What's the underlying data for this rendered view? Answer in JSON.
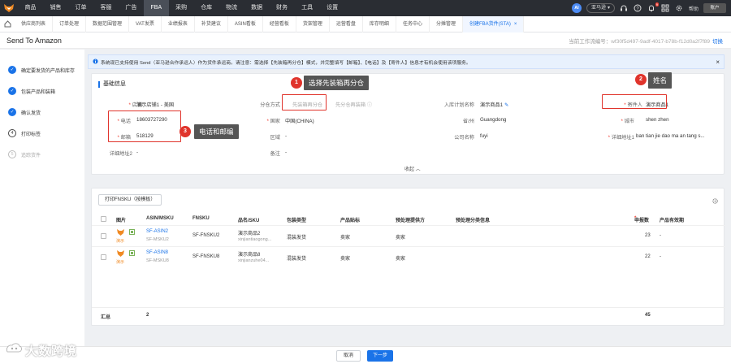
{
  "nav": {
    "items": [
      "商品",
      "销售",
      "订单",
      "客服",
      "广告",
      "FBA",
      "采购",
      "仓库",
      "物流",
      "数据",
      "财务",
      "工具",
      "设置"
    ],
    "active": "FBA",
    "ai_label": "AI",
    "user_label": "亚马逊",
    "notification_count": "9",
    "help_label": "帮助",
    "account_label": "账户"
  },
  "tabs": {
    "items": [
      "供应商列表",
      "订单处理",
      "数据范围管理",
      "VAT发票",
      "业绩报表",
      "补货建议",
      "ASIN看板",
      "经营看板",
      "货架管理",
      "运营看盘",
      "库存明细",
      "任务中心",
      "分摊管理"
    ],
    "active_label": "创建FBA货件(STA)",
    "close_glyph": "×"
  },
  "page": {
    "title": "Send To Amazon",
    "flow_label": "当前工作流编号：",
    "flow_id": "wf30f5d497-9adf-4017-b78b-f12d0a2f7f89",
    "switch_label": "切换"
  },
  "steps": [
    {
      "label": "确定要发货的产品和库存",
      "state": "done",
      "glyph": "✓"
    },
    {
      "label": "包装产品和装箱",
      "state": "done",
      "glyph": "✓"
    },
    {
      "label": "确认发货",
      "state": "done",
      "glyph": "✓"
    },
    {
      "label": "打印标签",
      "state": "current",
      "glyph": "4"
    },
    {
      "label": "追踪货件",
      "state": "todo",
      "glyph": "5"
    }
  ],
  "notice": {
    "text": "系统现已支持使用 Send（亚马逊合作承运人）作为货件承运商。请注意：需选择【先装箱再分仓】模式，并完整填写【邮箱】、【电话】及【寄件人】信息才有机会使用该项服务。",
    "close_glyph": "×"
  },
  "basic": {
    "title": "基础信息",
    "store_label": "店铺",
    "store_value": "演示店铺1 - 美国",
    "mode_label": "分仓方式",
    "mode_option1": "先装箱再分仓",
    "mode_option2": "先分仓再装箱",
    "plan_label": "入库计划名称",
    "plan_value": "演示商品1",
    "sender_label": "寄件人",
    "sender_value": "演示商品1",
    "phone_label": "电话",
    "phone_value": "18603727290",
    "country_label": "国家",
    "country_value": "中国(CHINA)",
    "province_label": "省/州",
    "province_value": "Guangdong",
    "city_label": "城市",
    "city_value": "shen zhen",
    "email_label": "邮箱",
    "email_value": "518129",
    "district_label": "区域",
    "district_value": "-",
    "company_label": "公司名称",
    "company_value": "fuyi",
    "address1_label": "详细地址1",
    "address1_value": "ban tian jie dao ma an tang s...",
    "address2_label": "详细地址2",
    "address2_value": "-",
    "remark_label": "备注",
    "remark_value": "-",
    "collapse_label": "收起 ︿"
  },
  "annotations": {
    "callout1_num": "1",
    "callout1_text": "选择先装箱再分仓",
    "callout2_num": "2",
    "callout2_text": "姓名",
    "callout3_num": "3",
    "callout3_text": "电话和邮编"
  },
  "product": {
    "print_button": "打印FNSKU（按模板）",
    "headers": [
      "图片",
      "ASIN/MSKU",
      "FNSKU",
      "品名/SKU",
      "包装类型",
      "产品贴标",
      "预处理提供方",
      "预处理分类信息",
      "申报数",
      "产品有效期"
    ],
    "rows": [
      {
        "thumb_label": "演示",
        "asin": "SF-ASIN2",
        "msku": "SF-MSKU2",
        "fnsku": "SF-FNSKU2",
        "name": "演示商品2",
        "sku": "xinjiantiaogong...",
        "pack": "混装发货",
        "label_by": "卖家",
        "prep_by": "卖家",
        "prep_info": "",
        "qty": "23",
        "expiry": "-"
      },
      {
        "thumb_label": "演示",
        "asin": "SF-ASIN8",
        "msku": "SF-MSKU8",
        "fnsku": "SF-FNSKU8",
        "name": "演示商品8",
        "sku": "xinjianzuhe04...",
        "pack": "混装发货",
        "label_by": "卖家",
        "prep_by": "卖家",
        "prep_info": "",
        "qty": "22",
        "expiry": "-"
      }
    ],
    "total_label": "汇总",
    "total_count": "2",
    "total_qty": "45"
  },
  "footer": {
    "cancel": "取消",
    "next": "下一步"
  },
  "watermark": "大数跨境",
  "colors": {
    "primary": "#1a73e8",
    "annotation_red": "#e0342c",
    "nav_bg": "#2a2d33"
  }
}
